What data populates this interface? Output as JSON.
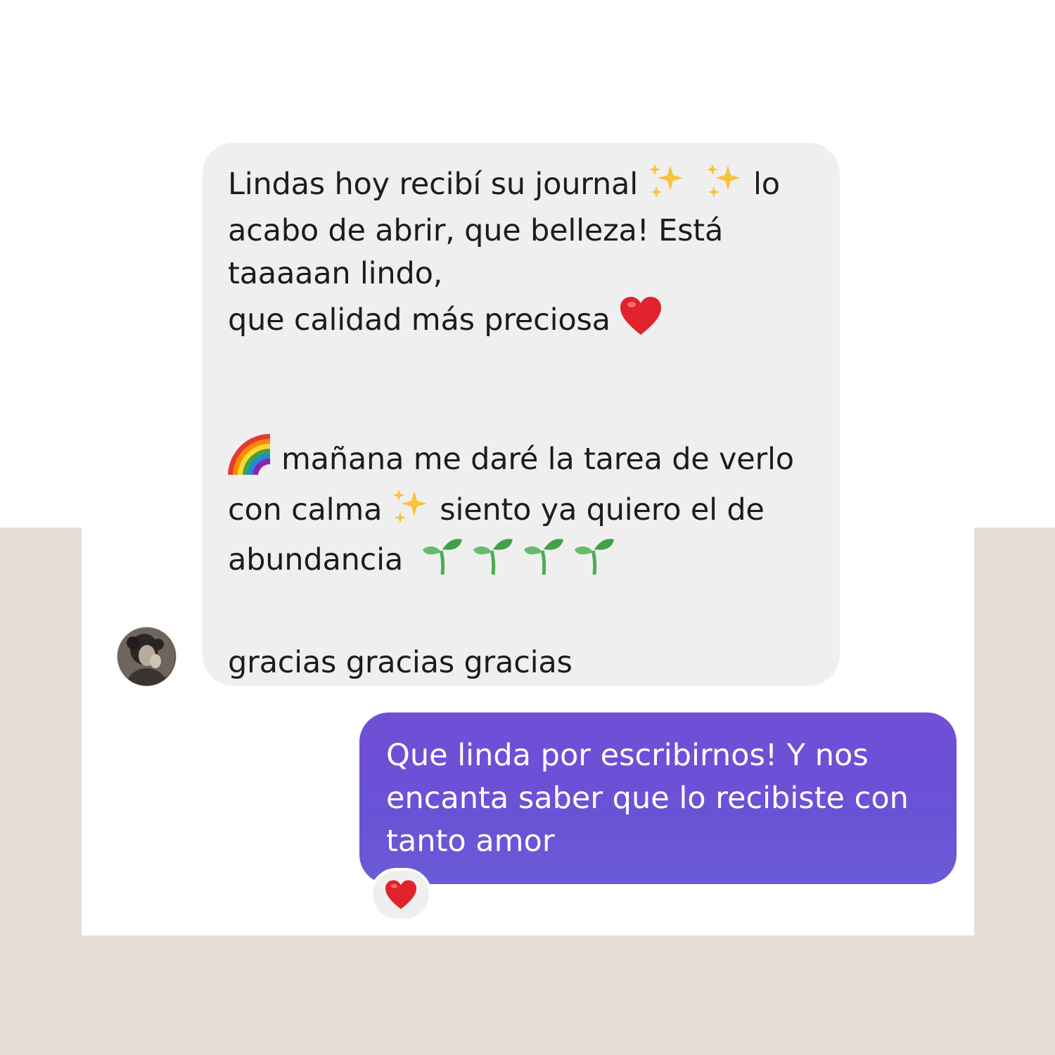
{
  "incoming_message": {
    "line1a": "Lindas hoy recibí su journal",
    "line1b": "lo",
    "line2": "acabo de abrir, que belleza! Está",
    "line3": "taaaaan lindo,",
    "line4": "que calidad más preciosa",
    "line5": "mañana me daré la tarea de verlo",
    "line6a": "con calma",
    "line6b": "siento ya quiero el de",
    "line7": "abundancia",
    "line8": "gracias gracias gracias"
  },
  "outgoing_message": {
    "line1": "Que linda por escribirnos! Y nos",
    "line2": "encanta saber que lo recibiste con",
    "line3": "tanto amor"
  },
  "icons": {
    "sparkles": "sparkles-icon",
    "heart": "red-heart-icon",
    "rainbow": "rainbow-icon",
    "seedling": "seedling-icon",
    "avatar": "avatar"
  },
  "colors": {
    "incoming_bubble": "#efefef",
    "outgoing_bubble": "#6a52d6",
    "background_beige": "#e8ddd6",
    "heart": "#e0232c"
  }
}
